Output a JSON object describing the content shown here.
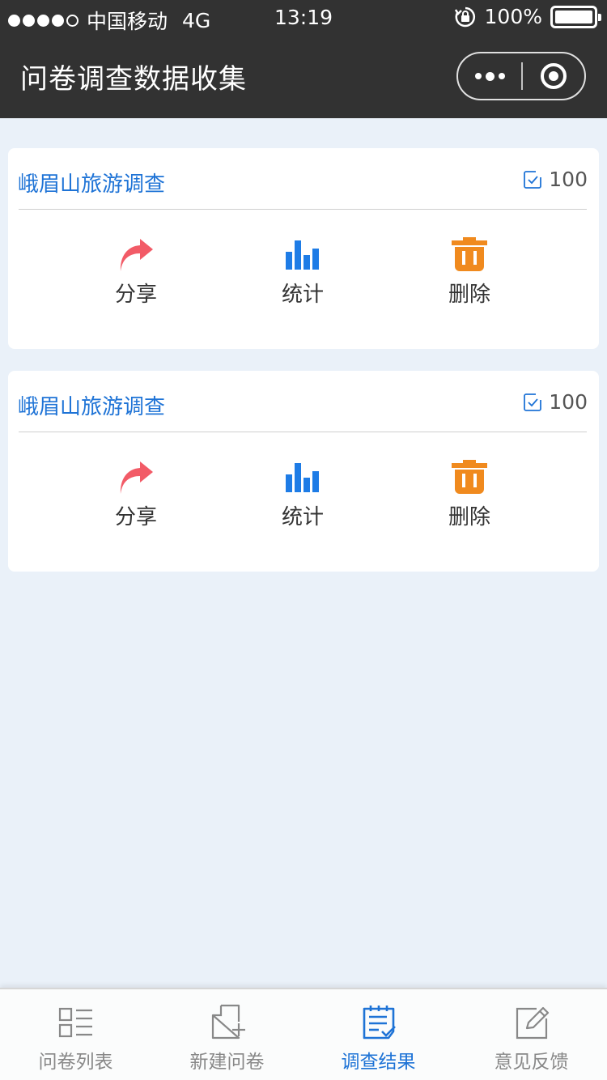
{
  "status_bar": {
    "carrier": "中国移动",
    "network": "4G",
    "time": "13:19",
    "battery": "100%"
  },
  "nav": {
    "title": "问卷调查数据收集"
  },
  "cards": [
    {
      "title": "峨眉山旅游调查",
      "count": "100",
      "actions": {
        "share": "分享",
        "stats": "统计",
        "delete": "删除"
      }
    },
    {
      "title": "峨眉山旅游调查",
      "count": "100",
      "actions": {
        "share": "分享",
        "stats": "统计",
        "delete": "删除"
      }
    }
  ],
  "tabbar": {
    "items": [
      {
        "label": "问卷列表",
        "icon": "list-icon"
      },
      {
        "label": "新建问卷",
        "icon": "new-doc-icon"
      },
      {
        "label": "调查结果",
        "icon": "results-icon",
        "active": true
      },
      {
        "label": "意见反馈",
        "icon": "feedback-edit-icon"
      }
    ]
  },
  "colors": {
    "nav_bg": "#323232",
    "page_bg": "#eaf1f9",
    "accent": "#1e73d6",
    "share": "#f25b67",
    "stats": "#1e7ce6",
    "delete": "#f08a1e"
  }
}
